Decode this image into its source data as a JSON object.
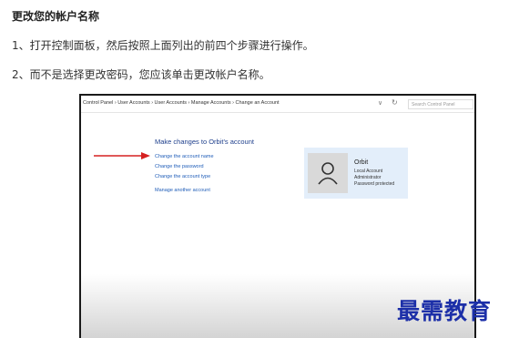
{
  "article": {
    "heading": "更改您的帐户名称",
    "steps": [
      "1、打开控制面板，然后按照上面列出的前四个步骤进行操作。",
      "2、而不是选择更改密码，您应该单击更改帐户名称。"
    ]
  },
  "screenshot": {
    "breadcrumb": "Control Panel  ›  User Accounts  ›  User Accounts  ›  Manage Accounts  ›  Change an Account",
    "search_placeholder": "Search Control Panel",
    "page_title": "Make changes to Orbit's account",
    "links": [
      "Change the account name",
      "Change the password",
      "Change the account type",
      "Manage another account"
    ],
    "account": {
      "name": "Orbit",
      "details": [
        "Local Account",
        "Administrator",
        "Password protected"
      ]
    },
    "arrow_color": "#d62020"
  },
  "watermark": "最需教育",
  "icons": {
    "dropdown": "chevron-down-icon",
    "refresh": "refresh-icon",
    "avatar": "user-icon",
    "arrow": "arrow-right-icon"
  }
}
